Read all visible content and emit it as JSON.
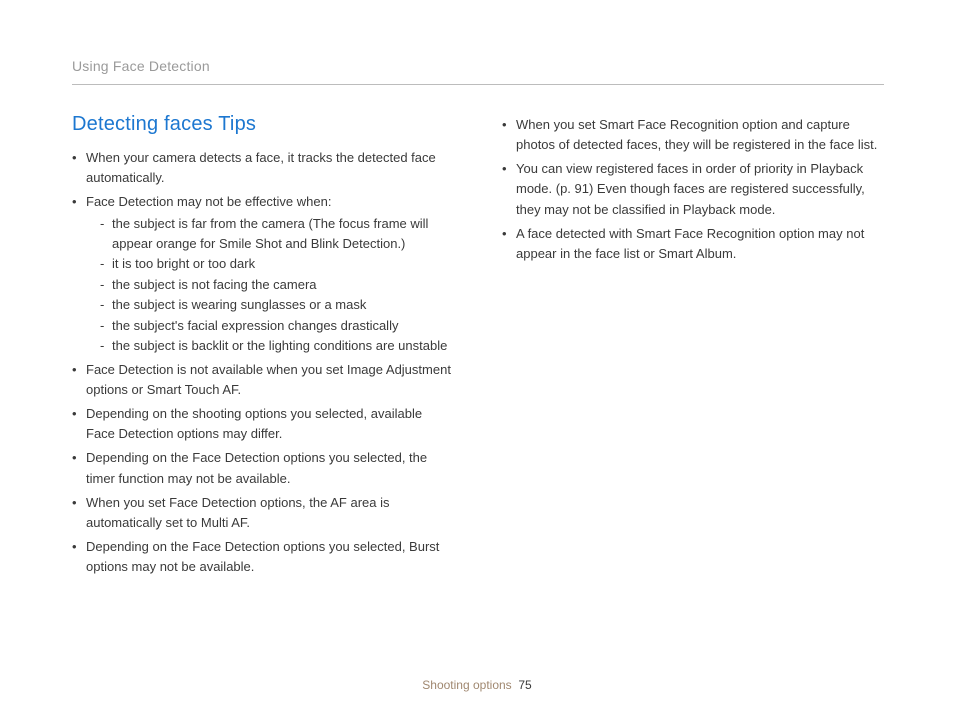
{
  "header": {
    "section": "Using Face Detection"
  },
  "left": {
    "title": "Detecting faces Tips",
    "b0": "When your camera detects a face, it tracks the detected face automatically.",
    "b1": "Face Detection may not be effective when:",
    "s0": "the subject is far from the camera (The focus frame will appear orange for Smile Shot and Blink Detection.)",
    "s1": "it is too bright or too dark",
    "s2": "the subject is not facing the camera",
    "s3": "the subject is wearing sunglasses or a mask",
    "s4": "the subject's facial expression changes drastically",
    "s5": "the subject is backlit or the lighting conditions are unstable",
    "b2": "Face Detection is not available when you set Image Adjustment options or Smart Touch AF.",
    "b3": "Depending on the shooting options you selected, available Face Detection options may differ.",
    "b4": "Depending on the Face Detection options you selected, the timer function may not be available.",
    "b5": "When you set Face Detection options, the AF area is automatically set to Multi AF.",
    "b6": "Depending on the Face Detection options you selected, Burst options may not be available."
  },
  "right": {
    "b0": "When you set Smart Face Recognition option and capture photos of detected faces, they will be registered in the face list.",
    "b1": "You can view registered faces in order of priority in Playback mode. (p. 91) Even though faces are registered successfully, they may not be classified in Playback mode.",
    "b2": "A face detected with Smart Face Recognition option may not appear in the face list or Smart Album."
  },
  "footer": {
    "label": "Shooting options",
    "page": "75"
  }
}
